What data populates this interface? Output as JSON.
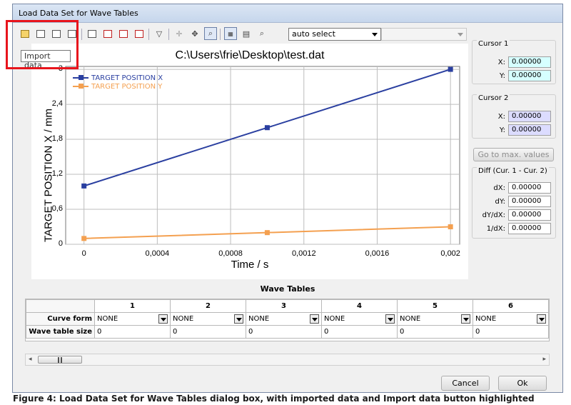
{
  "window": {
    "title": "Load Data Set for Wave Tables"
  },
  "toolbar": {
    "select_value": "auto select",
    "tooltip": "Import data",
    "icons": [
      "folder-open-icon",
      "copy-icon",
      "paste-icon",
      "export-icon",
      "properties-icon",
      "line-chart-icon",
      "curve-chart-icon",
      "bar-chart-icon",
      "filter-icon",
      "crosshair-icon",
      "pan-icon",
      "zoom-icon",
      "fit-icon",
      "grid-icon",
      "zoom-reset-icon"
    ]
  },
  "chart": {
    "title": "C:\\Users\\frie\\Desktop\\test.dat",
    "xlabel": "Time / s",
    "ylabel": "TARGET POSITION X / mm",
    "yticks": [
      "0",
      "0,6",
      "1,2",
      "1,8",
      "2,4",
      "3"
    ],
    "xticks": [
      "0",
      "0,0004",
      "0,0008",
      "0,0012",
      "0,0016",
      "0,002"
    ]
  },
  "chart_data": {
    "type": "line",
    "title": "C:\\Users\\frie\\Desktop\\test.dat",
    "xlabel": "Time / s",
    "ylabel": "TARGET POSITION X / mm",
    "xlim": [
      -0.0001,
      0.00205
    ],
    "ylim": [
      0,
      3.05
    ],
    "grid": true,
    "legend": "top-left",
    "series": [
      {
        "name": "TARGET POSITION X",
        "color": "#2a3fa0",
        "x": [
          0,
          0.001,
          0.002
        ],
        "y": [
          1.0,
          2.0,
          3.0
        ]
      },
      {
        "name": "TARGET POSITION Y",
        "color": "#f4a050",
        "x": [
          0,
          0.001,
          0.002
        ],
        "y": [
          0.1,
          0.2,
          0.3
        ]
      }
    ]
  },
  "cursor1": {
    "title": "Cursor 1",
    "x_label": "X:",
    "x": "0.00000",
    "y_label": "Y:",
    "y": "0.00000"
  },
  "cursor2": {
    "title": "Cursor 2",
    "x_label": "X:",
    "x": "0.00000",
    "y_label": "Y:",
    "y": "0.00000"
  },
  "goto_max": "Go to max. values",
  "diff": {
    "title": "Diff (Cur. 1 - Cur. 2)",
    "rows": [
      {
        "label": "dX:",
        "value": "0.00000"
      },
      {
        "label": "dY:",
        "value": "0.00000"
      },
      {
        "label": "dY/dX:",
        "value": "0.00000"
      },
      {
        "label": "1/dX:",
        "value": "0.00000"
      }
    ]
  },
  "wave_tables": {
    "title": "Wave Tables",
    "columns": [
      "1",
      "2",
      "3",
      "4",
      "5",
      "6"
    ],
    "curve_form_label": "Curve form",
    "curve_form_values": [
      "NONE",
      "NONE",
      "NONE",
      "NONE",
      "NONE",
      "NONE"
    ],
    "size_label": "Wave table size",
    "size_values": [
      "0",
      "0",
      "0",
      "0",
      "0",
      "0"
    ]
  },
  "buttons": {
    "cancel": "Cancel",
    "ok": "Ok"
  },
  "caption": "Figure 4: Load Data Set for Wave Tables dialog box, with imported data and Import data button highlighted"
}
